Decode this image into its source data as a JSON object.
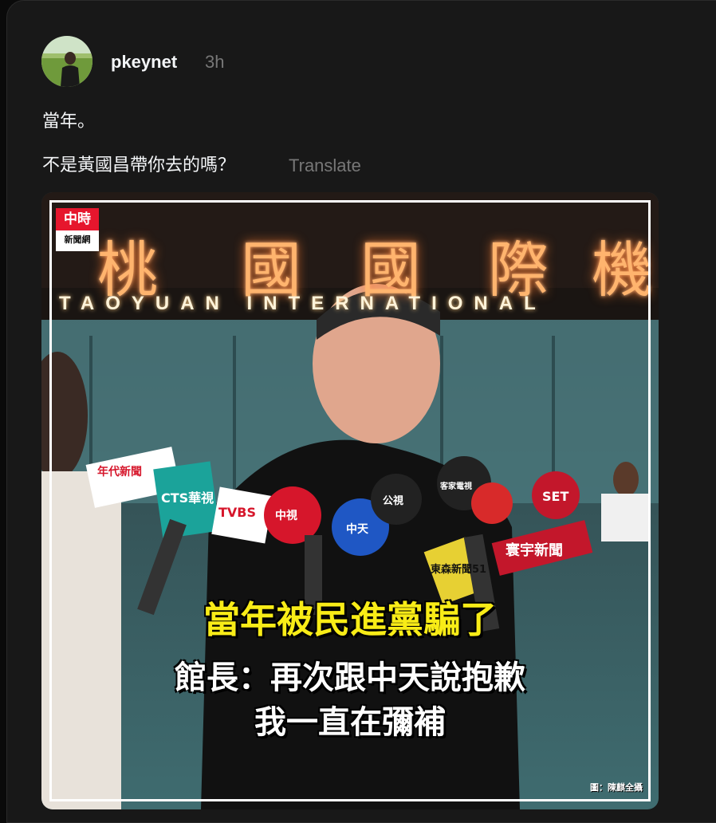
{
  "post": {
    "username": "pkeynet",
    "timestamp": "3h",
    "text_line1": "當年。",
    "text_line2": "不是黃國昌帶你去的嗎？",
    "translate_label": "Translate"
  },
  "image": {
    "logo_line1": "中時",
    "logo_line2": "新聞網",
    "sign_chinese": [
      "桃",
      "國",
      "國",
      "際",
      "機"
    ],
    "sign_english": "TAOYUAN INTERNATIONAL",
    "caption_line1": "當年被民進黨騙了",
    "caption_line2": "館長：再次跟中天說抱歉",
    "caption_line3": "我一直在彌補",
    "credit": "圖：陳麒全攝",
    "mic_labels": [
      "年代新聞",
      "CTS華視",
      "TVBS",
      "中視",
      "中天",
      "公視",
      "客家電視",
      "SET",
      "東森新聞51",
      "寰宇新聞"
    ]
  },
  "colors": {
    "background": "#181818",
    "caption_yellow": "#f8ec17",
    "secondary_text": "#777777"
  }
}
